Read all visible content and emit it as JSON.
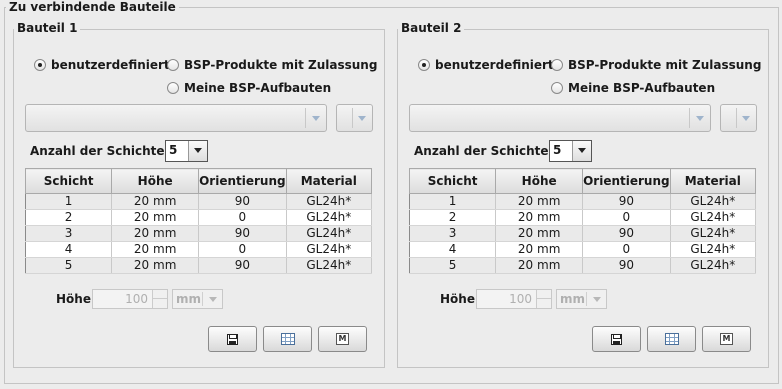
{
  "outer_title": "Zu verbindende Bauteile",
  "panels": [
    {
      "title": "Bauteil 1",
      "radio_options": [
        {
          "label": "benutzerdefiniert",
          "selected": true
        },
        {
          "label": "BSP-Produkte mit Zulassung",
          "selected": false
        },
        {
          "label": "Meine BSP-Aufbauten",
          "selected": false
        }
      ],
      "product_combo_value": "",
      "small_combo_value": "",
      "layers_label": "Anzahl der Schichten",
      "layers_count": "5",
      "table": {
        "headers": [
          "Schicht",
          "Höhe",
          "Orientierung",
          "Material"
        ],
        "rows": [
          [
            "1",
            "20 mm",
            "90",
            "GL24h*"
          ],
          [
            "2",
            "20 mm",
            "0",
            "GL24h*"
          ],
          [
            "3",
            "20 mm",
            "90",
            "GL24h*"
          ],
          [
            "4",
            "20 mm",
            "0",
            "GL24h*"
          ],
          [
            "5",
            "20 mm",
            "90",
            "GL24h*"
          ]
        ]
      },
      "height_label": "Höhe",
      "height_value": "100",
      "height_unit": "mm",
      "buttons": [
        {
          "name": "save",
          "icon": "save-icon"
        },
        {
          "name": "table",
          "icon": "table-icon"
        },
        {
          "name": "m",
          "icon": "m-icon",
          "text": "M"
        }
      ]
    },
    {
      "title": "Bauteil 2",
      "radio_options": [
        {
          "label": "benutzerdefiniert",
          "selected": true
        },
        {
          "label": "BSP-Produkte mit Zulassung",
          "selected": false
        },
        {
          "label": "Meine BSP-Aufbauten",
          "selected": false
        }
      ],
      "product_combo_value": "",
      "small_combo_value": "",
      "layers_label": "Anzahl der Schichten",
      "layers_count": "5",
      "table": {
        "headers": [
          "Schicht",
          "Höhe",
          "Orientierung",
          "Material"
        ],
        "rows": [
          [
            "1",
            "20 mm",
            "90",
            "GL24h*"
          ],
          [
            "2",
            "20 mm",
            "0",
            "GL24h*"
          ],
          [
            "3",
            "20 mm",
            "90",
            "GL24h*"
          ],
          [
            "4",
            "20 mm",
            "0",
            "GL24h*"
          ],
          [
            "5",
            "20 mm",
            "90",
            "GL24h*"
          ]
        ]
      },
      "height_label": "Höhe",
      "height_value": "100",
      "height_unit": "mm",
      "buttons": [
        {
          "name": "save",
          "icon": "save-icon"
        },
        {
          "name": "table",
          "icon": "table-icon"
        },
        {
          "name": "m",
          "icon": "m-icon",
          "text": "M"
        }
      ]
    }
  ]
}
